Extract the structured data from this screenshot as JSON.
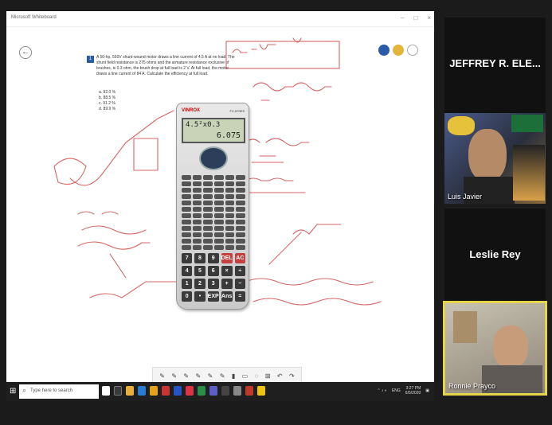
{
  "window": {
    "title": "Microsoft Whiteboard",
    "controls": [
      "–",
      "□",
      "×"
    ]
  },
  "question": {
    "number": "1",
    "text": "A 50-hp, 550V shunt-wound motor draws a line current of 4.5 A at no load. The shunt field resistance is 275 ohms and the armature resistance exclusive of brushes, is 0.3 ohm, the brush drop at full load is 2 V. At full load, the motor draws a line current of 84 A. Calculate the efficiency at full load.",
    "choices": [
      "a.   92.0 %",
      "b.   88.5 %",
      "c.   91.2 %",
      "d.   89.9 %"
    ]
  },
  "calculator": {
    "brand": "VINROX",
    "model": "FX-570ES",
    "display_expression": "4.5²x0.3",
    "display_result": "6.075",
    "keys": [
      "7",
      "8",
      "9",
      "DEL",
      "AC",
      "4",
      "5",
      "6",
      "×",
      "÷",
      "1",
      "2",
      "3",
      "+",
      "−",
      "0",
      "•",
      "EXP",
      "Ans",
      "="
    ]
  },
  "ink_toolbar": {
    "tools": [
      "pen",
      "pen",
      "pen",
      "pen",
      "pen",
      "pen",
      "highlighter",
      "eraser",
      "lasso",
      "ruler",
      "undo",
      "redo"
    ]
  },
  "taskbar": {
    "search_placeholder": "Type here to search",
    "time": "3:27 PM",
    "date": "6/5/2020",
    "lang": "ENG"
  },
  "participants": [
    {
      "name": "JEFFREY R. ELE..."
    },
    {
      "name": "Luis Javier"
    },
    {
      "name": "Leslie Rey"
    },
    {
      "name": "Ronnie Prayco"
    }
  ],
  "colors": {
    "ink": "#d04b4b",
    "accent": "#2a5ba8",
    "active_speaker": "#e6d44a"
  }
}
